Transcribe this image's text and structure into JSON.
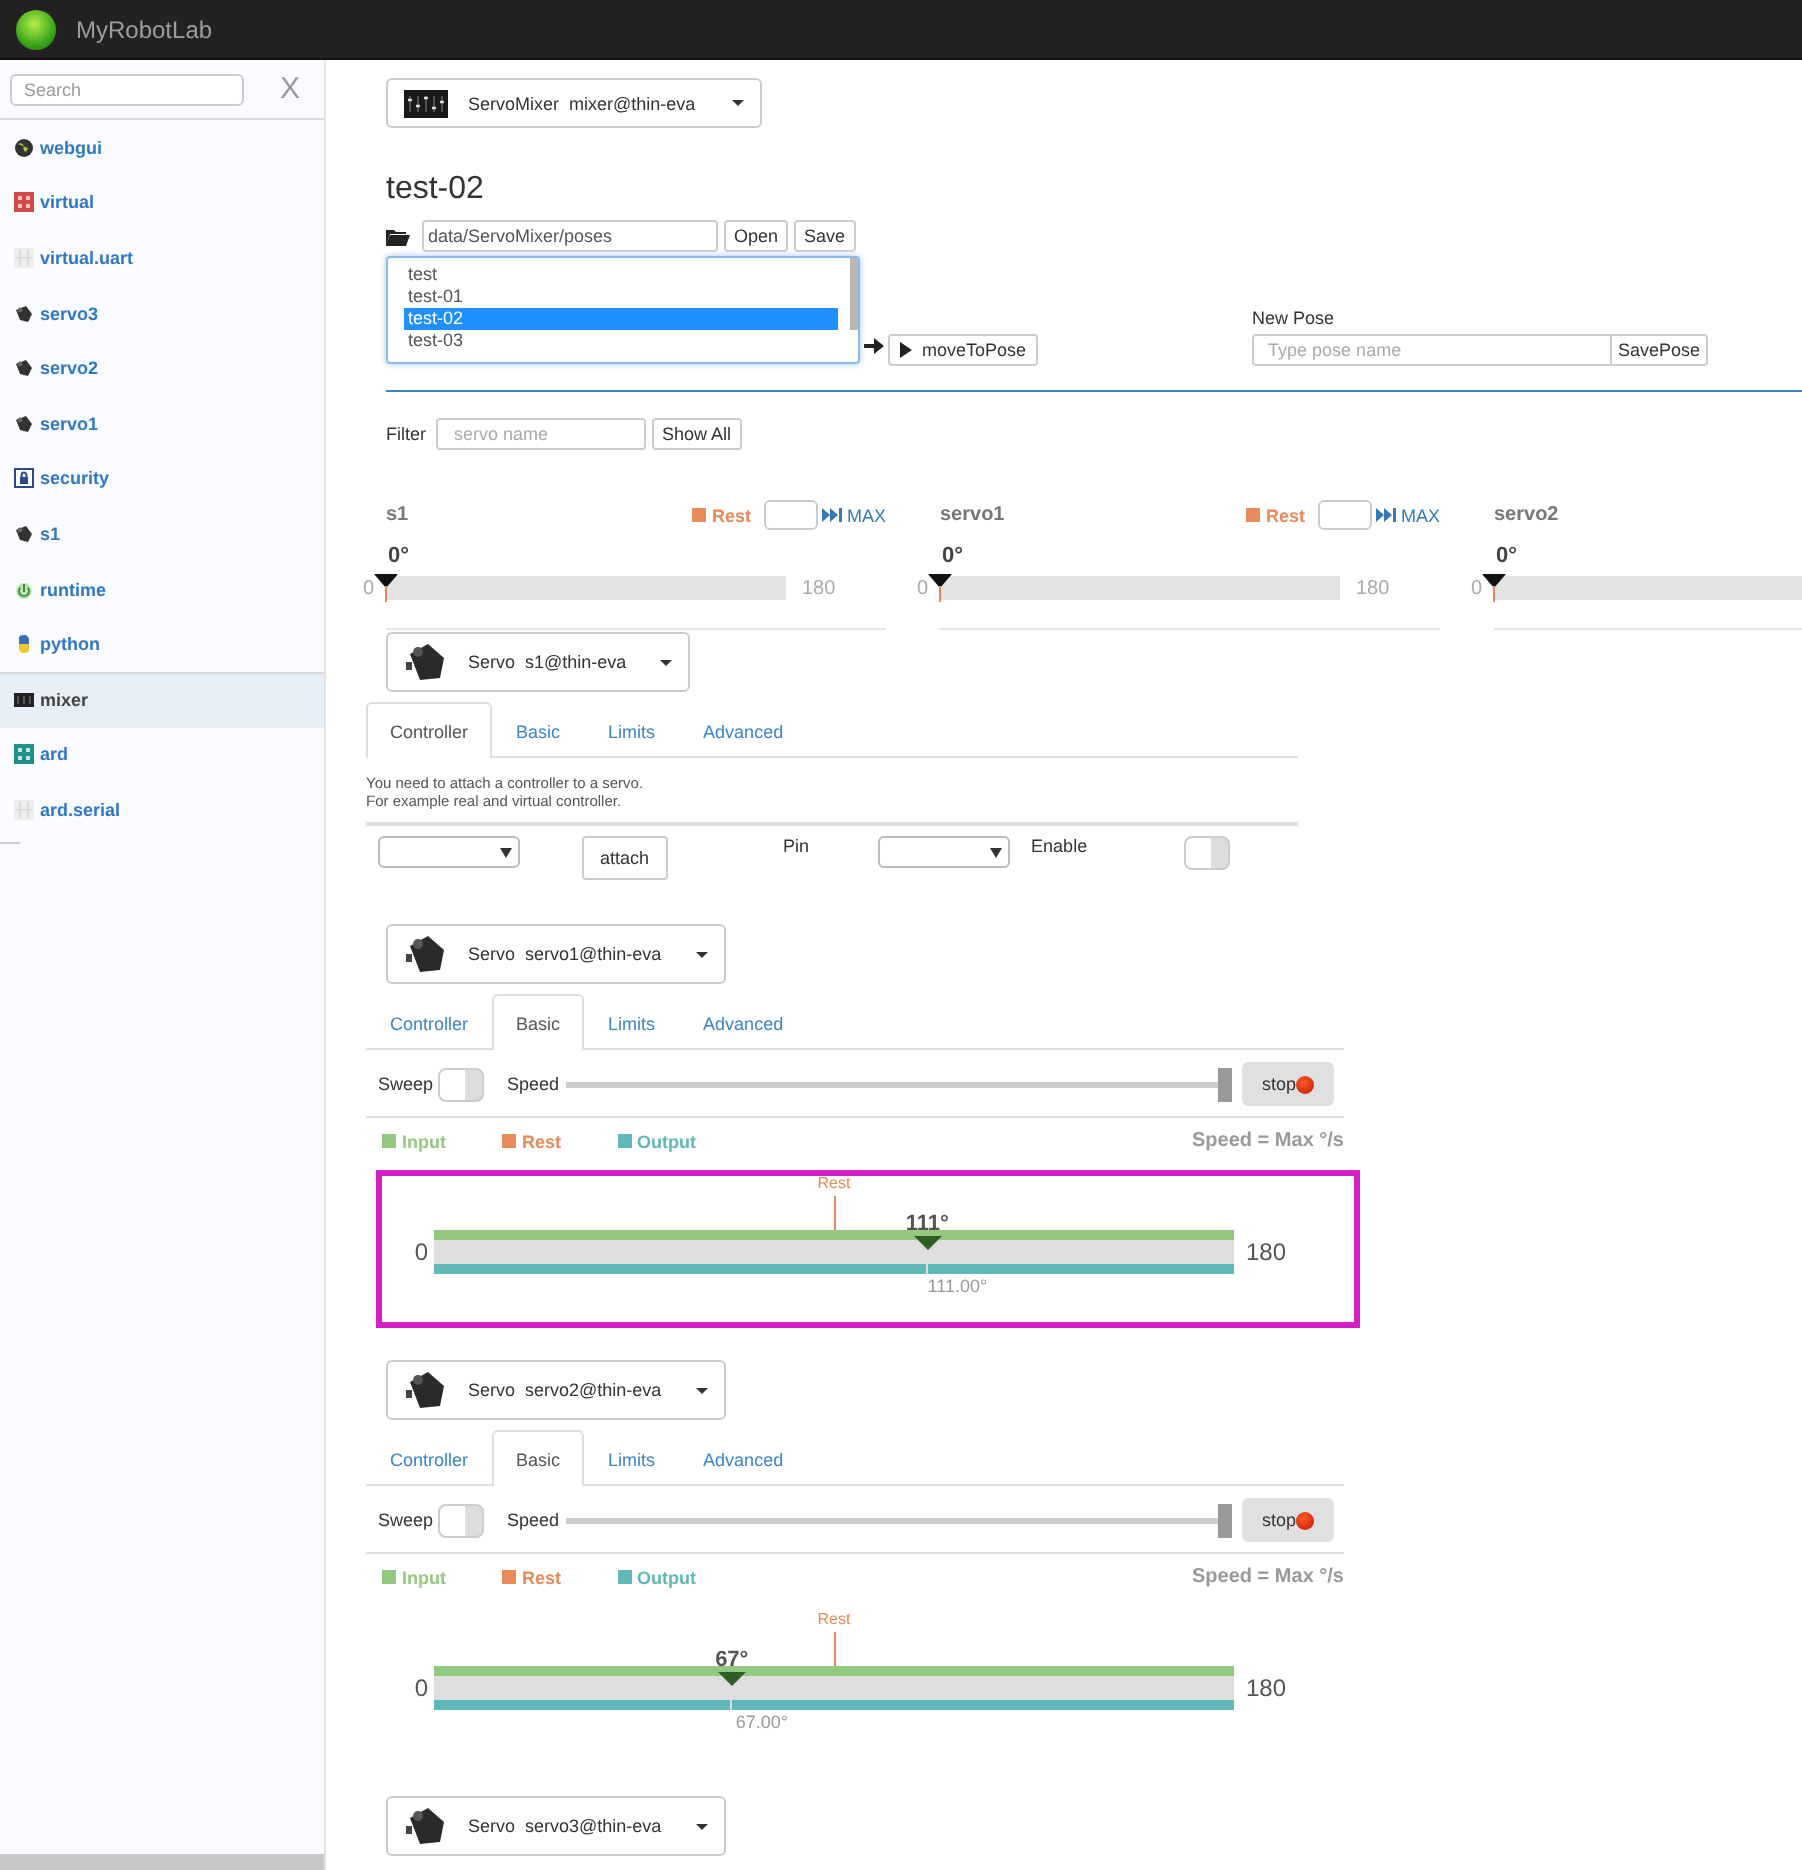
{
  "app": {
    "title": "MyRobotLab"
  },
  "sidebar": {
    "search": {
      "placeholder": "Search"
    },
    "clear": "X",
    "items": [
      {
        "label": "webgui",
        "selected": false
      },
      {
        "label": "virtual",
        "selected": false
      },
      {
        "label": "virtual.uart",
        "selected": false
      },
      {
        "label": "servo3",
        "selected": false
      },
      {
        "label": "servo2",
        "selected": false
      },
      {
        "label": "servo1",
        "selected": false
      },
      {
        "label": "security",
        "selected": false
      },
      {
        "label": "s1",
        "selected": false
      },
      {
        "label": "runtime",
        "selected": false
      },
      {
        "label": "python",
        "selected": false
      },
      {
        "label": "mixer",
        "selected": true
      },
      {
        "label": "ard",
        "selected": false
      },
      {
        "label": "ard.serial",
        "selected": false
      }
    ]
  },
  "service": {
    "type": "ServoMixer",
    "name": "mixer@thin-eva"
  },
  "pose_title": "test-02",
  "path": {
    "value": "data/ServoMixer/poses",
    "open": "Open",
    "save": "Save"
  },
  "poses": [
    {
      "label": "test",
      "selected": false
    },
    {
      "label": "test-01",
      "selected": false
    },
    {
      "label": "test-02",
      "selected": true
    },
    {
      "label": "test-03",
      "selected": false
    }
  ],
  "move_button": "moveToPose",
  "new_pose": {
    "label": "New Pose",
    "placeholder": "Type pose name",
    "button": "SavePose"
  },
  "filter": {
    "label": "Filter",
    "placeholder": "servo name",
    "button": "Show All"
  },
  "servo_columns": [
    {
      "name": "s1",
      "rest_label": "Rest",
      "max_label": "MAX",
      "reading": "0°",
      "min": "0",
      "max": "180",
      "level": 0
    },
    {
      "name": "servo1",
      "rest_label": "Rest",
      "max_label": "MAX",
      "reading": "0°",
      "min": "0",
      "max": "180",
      "level": 0
    },
    {
      "name": "servo2",
      "reading": "0°",
      "min": "0",
      "level": 0
    }
  ],
  "servo_panels": [
    {
      "kind": "controller",
      "type": "Servo",
      "name": "s1@thin-eva",
      "tabs": [
        {
          "label": "Controller",
          "selected": true
        },
        {
          "label": "Basic",
          "selected": false
        },
        {
          "label": "Limits",
          "selected": false
        },
        {
          "label": "Advanced",
          "selected": false
        }
      ],
      "message": [
        "You need to attach a controller to a servo.",
        "For example real and virtual controller."
      ],
      "attach": "attach",
      "pin_label": "Pin",
      "enable_label": "Enable",
      "enabled": false
    },
    {
      "kind": "basic",
      "type": "Servo",
      "name": "servo1@thin-eva",
      "tabs": [
        {
          "label": "Controller",
          "selected": false
        },
        {
          "label": "Basic",
          "selected": true
        },
        {
          "label": "Limits",
          "selected": false
        },
        {
          "label": "Advanced",
          "selected": false
        }
      ],
      "sweep_label": "Sweep",
      "sweep": false,
      "speed_label": "Speed",
      "speed": {
        "level": 1
      },
      "stop": "stop",
      "legend": [
        {
          "label": "Input",
          "color": "#93c97f"
        },
        {
          "label": "Rest",
          "color": "#e8895a"
        },
        {
          "label": "Output",
          "color": "#5fb7b7"
        }
      ],
      "speed_reading": "Speed = Max °/s",
      "position": {
        "highlighted": true,
        "min": "0",
        "max": "180",
        "rest": {
          "label": "Rest",
          "level": 0.5
        },
        "input": {
          "reading": "111°",
          "level": 0.6167
        },
        "output": {
          "reading": "111.00°",
          "level": 0.6167
        }
      }
    },
    {
      "kind": "basic",
      "type": "Servo",
      "name": "servo2@thin-eva",
      "tabs": [
        {
          "label": "Controller",
          "selected": false
        },
        {
          "label": "Basic",
          "selected": true
        },
        {
          "label": "Limits",
          "selected": false
        },
        {
          "label": "Advanced",
          "selected": false
        }
      ],
      "sweep_label": "Sweep",
      "sweep": false,
      "speed_label": "Speed",
      "speed": {
        "level": 1
      },
      "stop": "stop",
      "legend": [
        {
          "label": "Input",
          "color": "#93c97f"
        },
        {
          "label": "Rest",
          "color": "#e8895a"
        },
        {
          "label": "Output",
          "color": "#5fb7b7"
        }
      ],
      "speed_reading": "Speed = Max °/s",
      "position": {
        "highlighted": false,
        "min": "0",
        "max": "180",
        "rest": {
          "label": "Rest",
          "level": 0.5
        },
        "input": {
          "reading": "67°",
          "level": 0.3722
        },
        "output": {
          "reading": "67.00°",
          "level": 0.3722
        }
      }
    },
    {
      "kind": "collapsed",
      "type": "Servo",
      "name": "servo3@thin-eva"
    }
  ]
}
